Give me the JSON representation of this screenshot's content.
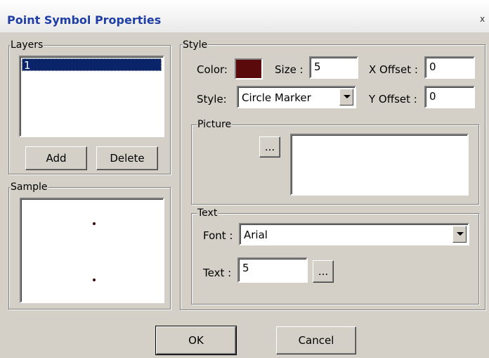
{
  "window": {
    "title": "Point Symbol Properties",
    "close_glyph": "x"
  },
  "layers": {
    "legend": "Layers",
    "items": [
      "1"
    ],
    "selected_index": 0,
    "add_label": "Add",
    "delete_label": "Delete"
  },
  "sample": {
    "legend": "Sample",
    "dot_color": "#3b0707"
  },
  "style": {
    "legend": "Style",
    "color_label": "Color:",
    "color_value": "#5a0a0a",
    "size_label": "Size :",
    "size_value": "5",
    "x_offset_label": "X Offset :",
    "x_offset_value": "0",
    "style_label": "Style:",
    "style_value": "Circle Marker",
    "y_offset_label": "Y Offset :",
    "y_offset_value": "0"
  },
  "picture": {
    "legend": "Picture",
    "browse_label": "..."
  },
  "text_group": {
    "legend": "Text",
    "font_label": "Font :",
    "font_value": "Arial",
    "text_label": "Text :",
    "text_value": "5",
    "browse_label": "..."
  },
  "buttons": {
    "ok_label": "OK",
    "cancel_label": "Cancel"
  },
  "colors": {
    "title_text": "#1f3fa6",
    "dialog_bg": "#d4d0c8",
    "selection": "#0a246a"
  }
}
